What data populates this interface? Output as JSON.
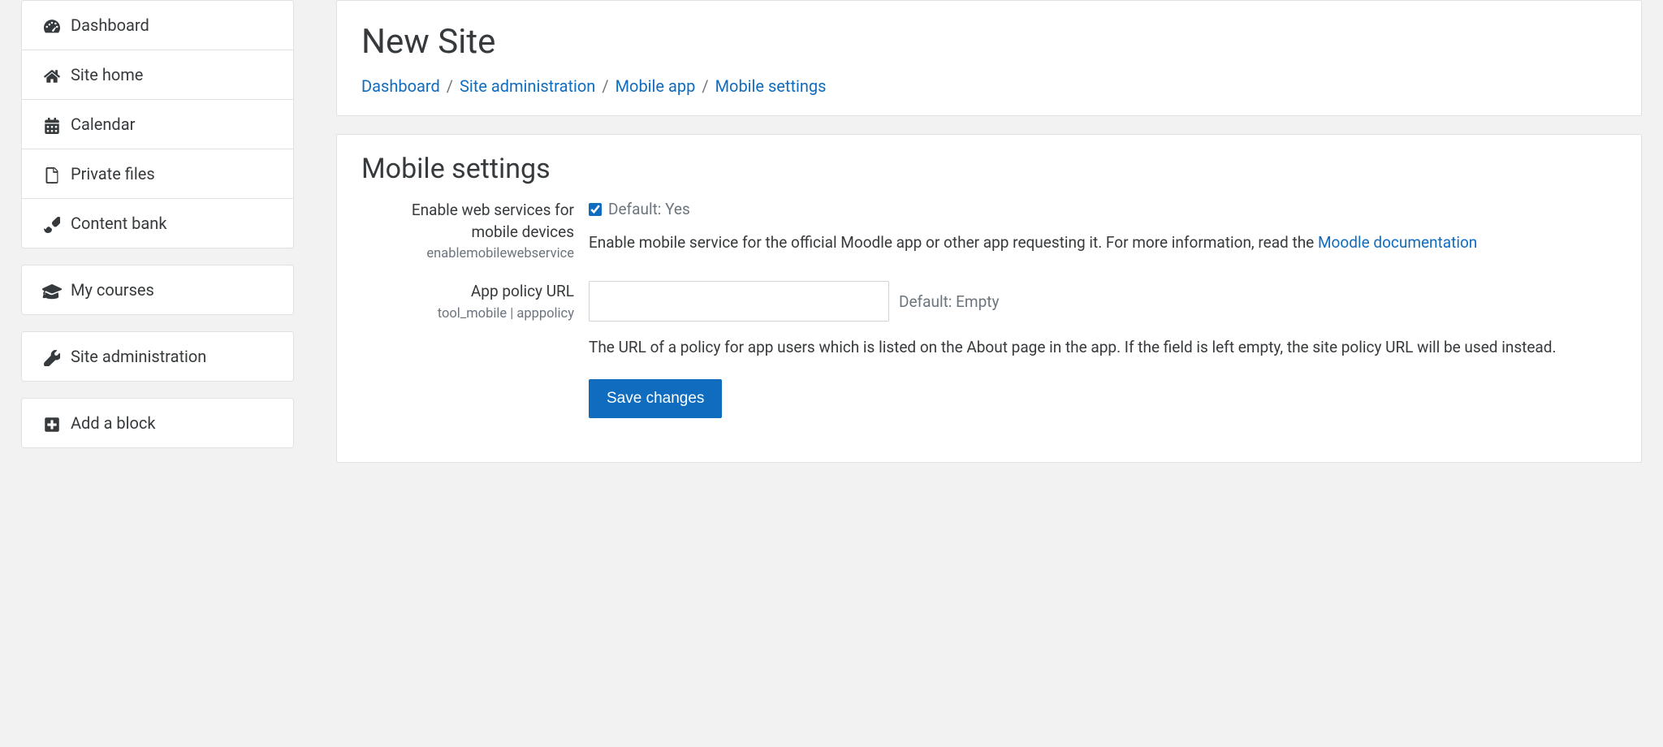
{
  "sidebar": {
    "groups": [
      {
        "items": [
          {
            "label": "Dashboard",
            "icon": "dashboard-icon"
          },
          {
            "label": "Site home",
            "icon": "home-icon"
          },
          {
            "label": "Calendar",
            "icon": "calendar-icon"
          },
          {
            "label": "Private files",
            "icon": "file-icon"
          },
          {
            "label": "Content bank",
            "icon": "brush-icon"
          }
        ]
      },
      {
        "items": [
          {
            "label": "My courses",
            "icon": "graduation-icon"
          }
        ]
      },
      {
        "items": [
          {
            "label": "Site administration",
            "icon": "wrench-icon"
          }
        ]
      },
      {
        "items": [
          {
            "label": "Add a block",
            "icon": "plus-square-icon"
          }
        ]
      }
    ]
  },
  "header": {
    "title": "New Site",
    "breadcrumb": [
      "Dashboard",
      "Site administration",
      "Mobile app",
      "Mobile settings"
    ]
  },
  "settings": {
    "title": "Mobile settings",
    "enable_ws": {
      "label": "Enable web services for mobile devices",
      "sublabel": "enablemobilewebservice",
      "checked": true,
      "default_text": "Default: Yes",
      "desc_prefix": "Enable mobile service for the official Moodle app or other app requesting it. For more information, read the ",
      "desc_link": "Moodle documentation"
    },
    "app_policy": {
      "label": "App policy URL",
      "sublabel": "tool_mobile | apppolicy",
      "value": "",
      "default_text": "Default: Empty",
      "desc": "The URL of a policy for app users which is listed on the About page in the app. If the field is left empty, the site policy URL will be used instead."
    },
    "save_label": "Save changes"
  }
}
